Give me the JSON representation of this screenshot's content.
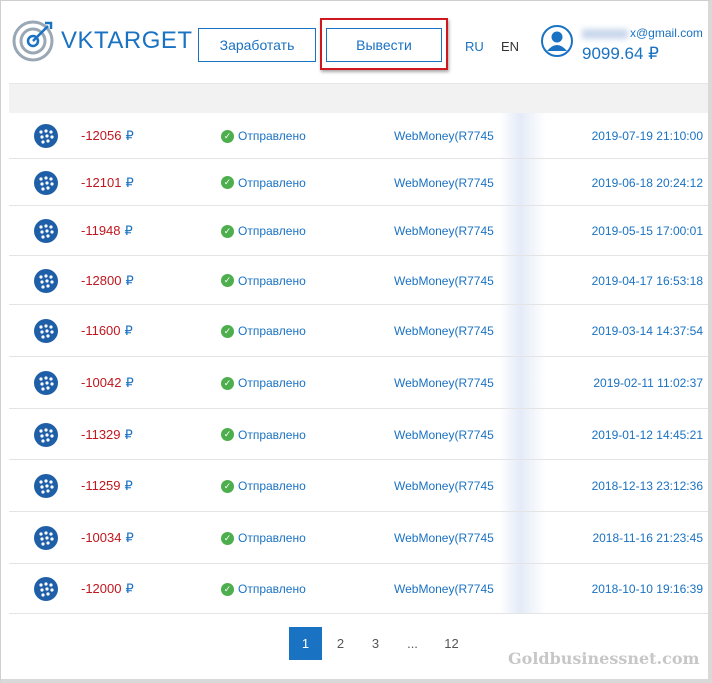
{
  "header": {
    "logo_text": "VKTARGET",
    "earn_label": "Заработать",
    "withdraw_label": "Вывести",
    "lang_ru": "RU",
    "lang_en": "EN",
    "user_email": "x@gmail.com",
    "balance": "9099.64 ₽"
  },
  "colors": {
    "brand": "#1a72c2",
    "amount": "#c0161e",
    "highlight": "#d0161e",
    "status_ok": "#4cae4c"
  },
  "transactions": [
    {
      "amount": "-12056",
      "currency": "₽",
      "status": "Отправлено",
      "wallet": "WebMoney(R7745",
      "date": "2019-07-19 21:10:00"
    },
    {
      "amount": "-12101",
      "currency": "₽",
      "status": "Отправлено",
      "wallet": "WebMoney(R7745",
      "date": "2019-06-18 20:24:12"
    },
    {
      "amount": "-11948",
      "currency": "₽",
      "status": "Отправлено",
      "wallet": "WebMoney(R7745",
      "date": "2019-05-15 17:00:01"
    },
    {
      "amount": "-12800",
      "currency": "₽",
      "status": "Отправлено",
      "wallet": "WebMoney(R7745",
      "date": "2019-04-17 16:53:18"
    },
    {
      "amount": "-11600",
      "currency": "₽",
      "status": "Отправлено",
      "wallet": "WebMoney(R7745",
      "date": "2019-03-14 14:37:54"
    },
    {
      "amount": "-10042",
      "currency": "₽",
      "status": "Отправлено",
      "wallet": "WebMoney(R7745",
      "date": "2019-02-11 11:02:37"
    },
    {
      "amount": "-11329",
      "currency": "₽",
      "status": "Отправлено",
      "wallet": "WebMoney(R7745",
      "date": "2019-01-12 14:45:21"
    },
    {
      "amount": "-11259",
      "currency": "₽",
      "status": "Отправлено",
      "wallet": "WebMoney(R7745",
      "date": "2018-12-13 23:12:36"
    },
    {
      "amount": "-10034",
      "currency": "₽",
      "status": "Отправлено",
      "wallet": "WebMoney(R7745",
      "date": "2018-11-16 21:23:45"
    },
    {
      "amount": "-12000",
      "currency": "₽",
      "status": "Отправлено",
      "wallet": "WebMoney(R7745",
      "date": "2018-10-10 19:16:39"
    }
  ],
  "pagination": {
    "pages": [
      "1",
      "2",
      "3",
      "...",
      "12"
    ],
    "current": "1"
  },
  "watermark": "Goldbusinessnet.com"
}
